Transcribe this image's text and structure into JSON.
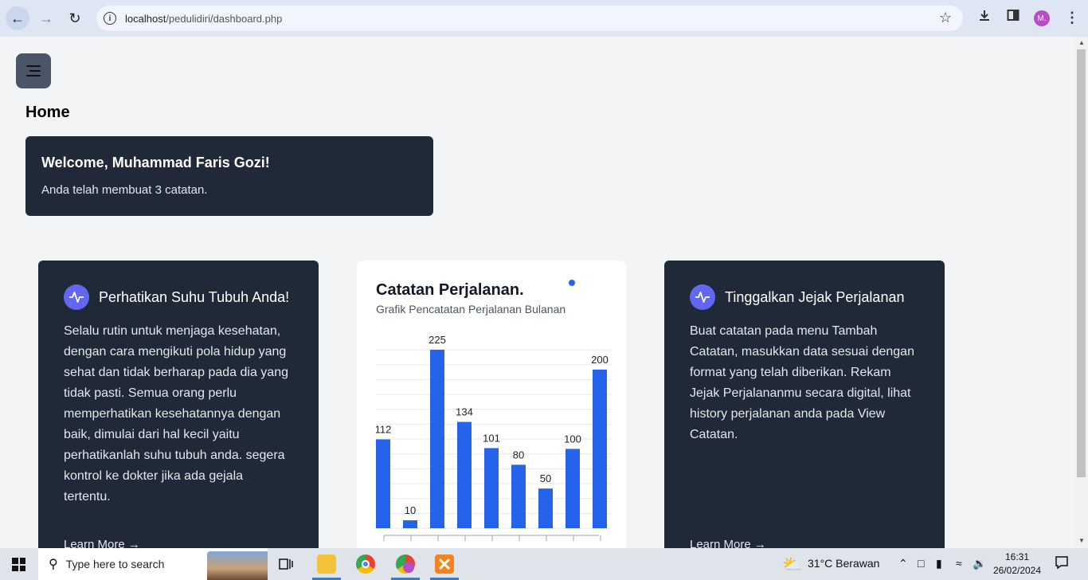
{
  "browser": {
    "url_host": "localhost",
    "url_path": "/pedulidiri/dashboard.php",
    "profile_initial": "M."
  },
  "page": {
    "title": "Home",
    "welcome": {
      "heading": "Welcome, Muhammad Faris Gozi!",
      "text": "Anda telah membuat 3 catatan."
    },
    "card_left": {
      "title": "Perhatikan Suhu Tubuh Anda!",
      "body": "Selalu rutin untuk menjaga kesehatan, dengan cara mengikuti pola hidup yang sehat dan tidak berharap pada dia yang tidak pasti. Semua orang perlu memperhatikan kesehatannya dengan baik, dimulai dari hal kecil yaitu perhatikanlah suhu tubuh anda. segera kontrol ke dokter jika ada gejala tertentu.",
      "link": "Learn More"
    },
    "chart_card": {
      "title": "Catatan Perjalanan.",
      "subtitle": "Grafik Pencatatan Perjalanan Bulanan"
    },
    "card_right": {
      "title": "Tinggalkan Jejak Perjalanan",
      "body": "Buat catatan pada menu Tambah Catatan, masukkan data sesuai dengan format yang telah diberikan. Rekam Jejak Perjalananmu secara digital, lihat history perjalanan anda pada View Catatan.",
      "link": "Learn More"
    },
    "accent_color": "#2563eb",
    "dark_card_color": "#1f2937"
  },
  "chart_data": {
    "type": "bar",
    "title": "Catatan Perjalanan.",
    "subtitle": "Grafik Pencatatan Perjalanan Bulanan",
    "categories": [
      "",
      "",
      "",
      "",
      "",
      "",
      "",
      "",
      ""
    ],
    "values": [
      112,
      10,
      225,
      134,
      101,
      80,
      50,
      100,
      200
    ],
    "ylim": [
      0,
      225
    ],
    "grid": true,
    "color": "#2563eb"
  },
  "taskbar": {
    "search_placeholder": "Type here to search",
    "weather": "31°C  Berawan",
    "time": "16:31",
    "date": "26/02/2024"
  }
}
